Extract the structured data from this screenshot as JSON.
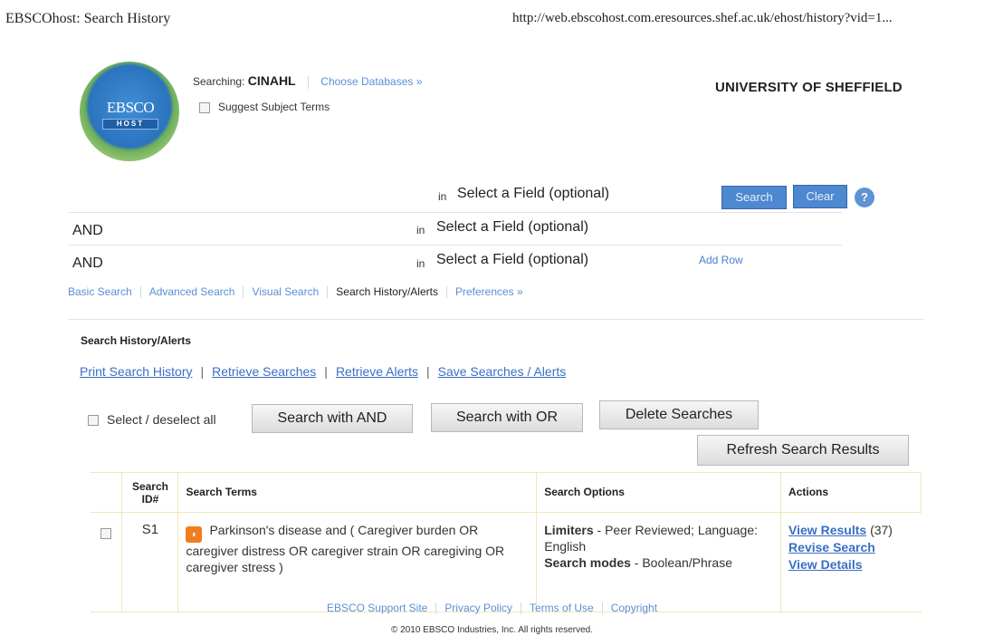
{
  "print_header": {
    "title": "EBSCOhost: Search History",
    "url": "http://web.ebscohost.com.eresources.shef.ac.uk/ehost/history?vid=1..."
  },
  "logo": {
    "line1": "EBSCO",
    "line2": "HOST"
  },
  "searching": {
    "label": "Searching:",
    "database": "CINAHL",
    "choose_link": "Choose Databases »"
  },
  "suggest_label": "Suggest Subject Terms",
  "institution": "UNIVERSITY OF SHEFFIELD",
  "search_rows": [
    {
      "bool": "",
      "in": "in",
      "field": "Select a Field (optional)"
    },
    {
      "bool": "AND",
      "in": "in",
      "field": "Select a Field (optional)"
    },
    {
      "bool": "AND",
      "in": "in",
      "field": "Select a Field (optional)"
    }
  ],
  "buttons": {
    "search": "Search",
    "clear": "Clear",
    "help": "?"
  },
  "add_row": "Add Row",
  "nav_tabs": [
    "Basic Search",
    "Advanced Search",
    "Visual Search",
    "Search History/Alerts",
    "Preferences »"
  ],
  "section_title": "Search History/Alerts",
  "history_links": [
    "Print Search History",
    "Retrieve Searches",
    "Retrieve Alerts",
    "Save Searches / Alerts"
  ],
  "select_all": "Select / deselect all",
  "history_buttons": {
    "and": "Search with AND",
    "or": "Search with OR",
    "delete": "Delete Searches",
    "refresh": "Refresh Search Results"
  },
  "table": {
    "headers": {
      "id_line1": "Search",
      "id_line2": "ID#",
      "terms": "Search Terms",
      "options": "Search Options",
      "actions": "Actions"
    },
    "rows": [
      {
        "id": "S1",
        "terms": "Parkinson's disease and ( Caregiver burden OR caregiver distress OR caregiver strain OR caregiving OR caregiver stress )",
        "limiters_label": "Limiters",
        "limiters_text": " - Peer Reviewed; Language: English",
        "modes_label": "Search modes",
        "modes_text": " - Boolean/Phrase",
        "view_results": "View Results",
        "result_count": "(37)",
        "revise": "Revise Search",
        "details": "View Details"
      }
    ]
  },
  "footer_links": [
    "EBSCO Support Site",
    "Privacy Policy",
    "Terms of Use",
    "Copyright"
  ],
  "copyright": "© 2010 EBSCO Industries, Inc. All rights reserved.",
  "colors": {
    "link": "#3a6fc4",
    "button_blue": "#4d88d0",
    "table_border": "#f0e6b8"
  }
}
